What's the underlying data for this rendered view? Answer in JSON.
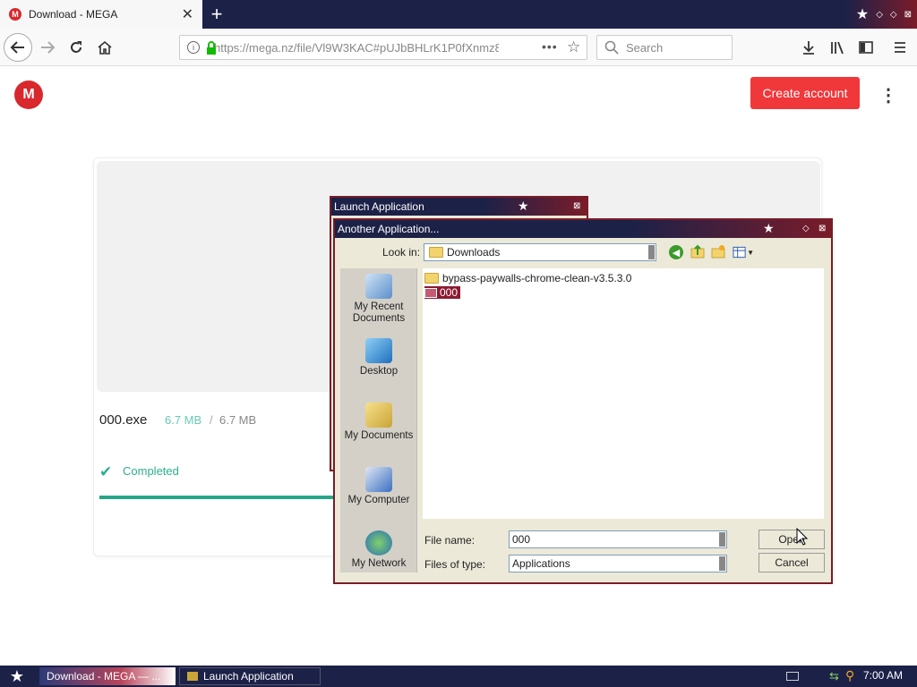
{
  "browser": {
    "tab_title": "Download - MEGA",
    "tab_close": "✕",
    "new_tab": "+",
    "url": "https://mega.nz/file/Vl9W3KAC#pUJbBHLrK1P0fXnmz8",
    "search_placeholder": "Search"
  },
  "page": {
    "logo_letter": "M",
    "create_account_label": "Create account",
    "file_name": "000.exe",
    "size_downloaded": "6.7 MB",
    "size_separator": "/",
    "size_total": "6.7 MB",
    "status_text": "Completed",
    "progress_fraction": 1.0
  },
  "launch_dialog": {
    "title": "Launch Application"
  },
  "open_dialog": {
    "title": "Another Application...",
    "look_in_label": "Look in:",
    "look_in_value": "Downloads",
    "places": [
      {
        "label": "My Recent Documents"
      },
      {
        "label": "Desktop"
      },
      {
        "label": "My Documents"
      },
      {
        "label": "My Computer"
      },
      {
        "label": "My Network"
      }
    ],
    "files": [
      {
        "name": "bypass-paywalls-chrome-clean-v3.5.3.0",
        "type": "folder"
      },
      {
        "name": "000",
        "type": "app",
        "selected": true
      }
    ],
    "file_name_label": "File name:",
    "file_name_value": "000",
    "files_of_type_label": "Files of type:",
    "files_of_type_value": "Applications",
    "open_label": "Open",
    "cancel_label": "Cancel"
  },
  "taskbar": {
    "items": [
      {
        "label": "Download - MEGA — ..."
      },
      {
        "label": "Launch Application"
      }
    ],
    "clock": "7:00 AM"
  },
  "colors": {
    "mega_red": "#d9272e",
    "create_account_bg": "#f0373a",
    "success_green": "#2bb08d",
    "titlebar_navy": "#1c2148",
    "selection_maroon": "#8b1a30"
  }
}
